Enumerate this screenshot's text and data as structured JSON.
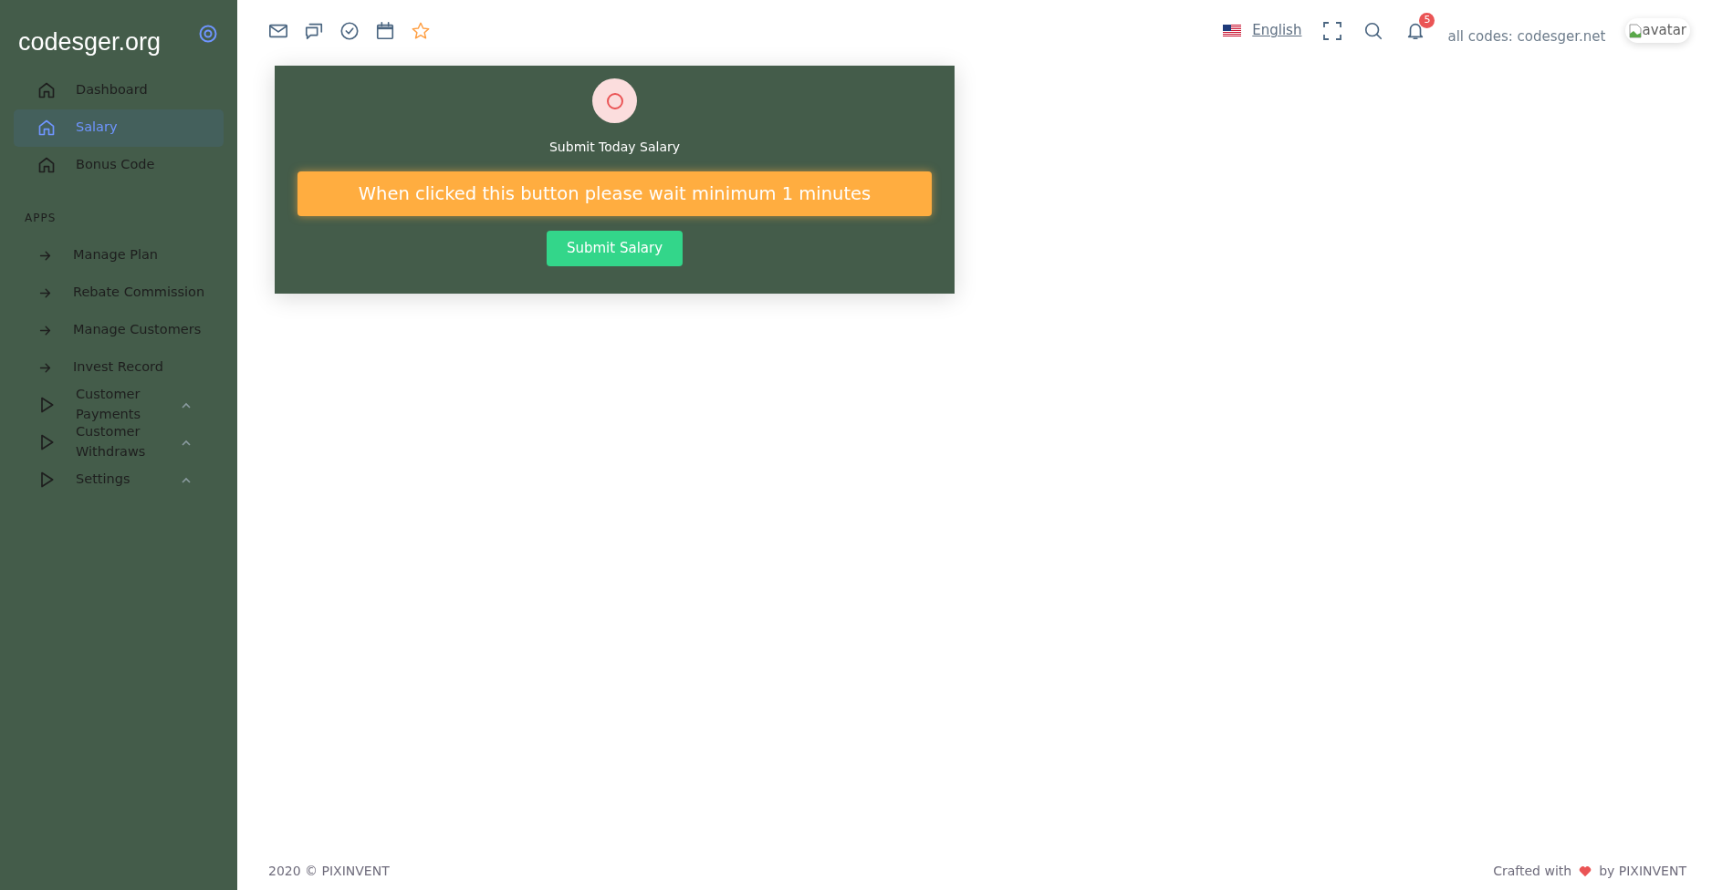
{
  "sidebar": {
    "brand": "codesger.org",
    "items": [
      {
        "label": "Dashboard",
        "kind": "home",
        "selected": false
      },
      {
        "label": "Salary",
        "kind": "home",
        "selected": true
      },
      {
        "label": "Bonus Code",
        "kind": "home",
        "selected": false
      }
    ],
    "section_title": "APPS",
    "apps": [
      {
        "label": "Manage Plan",
        "kind": "arrow",
        "expanded": false
      },
      {
        "label": "Rebate Commission",
        "kind": "arrow",
        "expanded": false
      },
      {
        "label": "Manage Customers",
        "kind": "arrow",
        "expanded": false
      },
      {
        "label": "Invest Record",
        "kind": "arrow",
        "expanded": false
      },
      {
        "label": "Customer Payments",
        "kind": "play",
        "expanded": true
      },
      {
        "label": "Customer Withdraws",
        "kind": "play",
        "expanded": true
      },
      {
        "label": "Settings",
        "kind": "play",
        "expanded": true
      }
    ]
  },
  "navbar": {
    "language": "English",
    "notification_count": "5",
    "note": "all codes: codesger.net",
    "avatar_alt": "avatar"
  },
  "card": {
    "title": "Submit Today Salary",
    "alert": "When clicked this button please wait minimum 1 minutes",
    "button": "Submit Salary"
  },
  "footer": {
    "copyright": "2020 © PIXINVENT",
    "crafted_before": "Crafted with",
    "crafted_after": "by PIXINVENT"
  }
}
